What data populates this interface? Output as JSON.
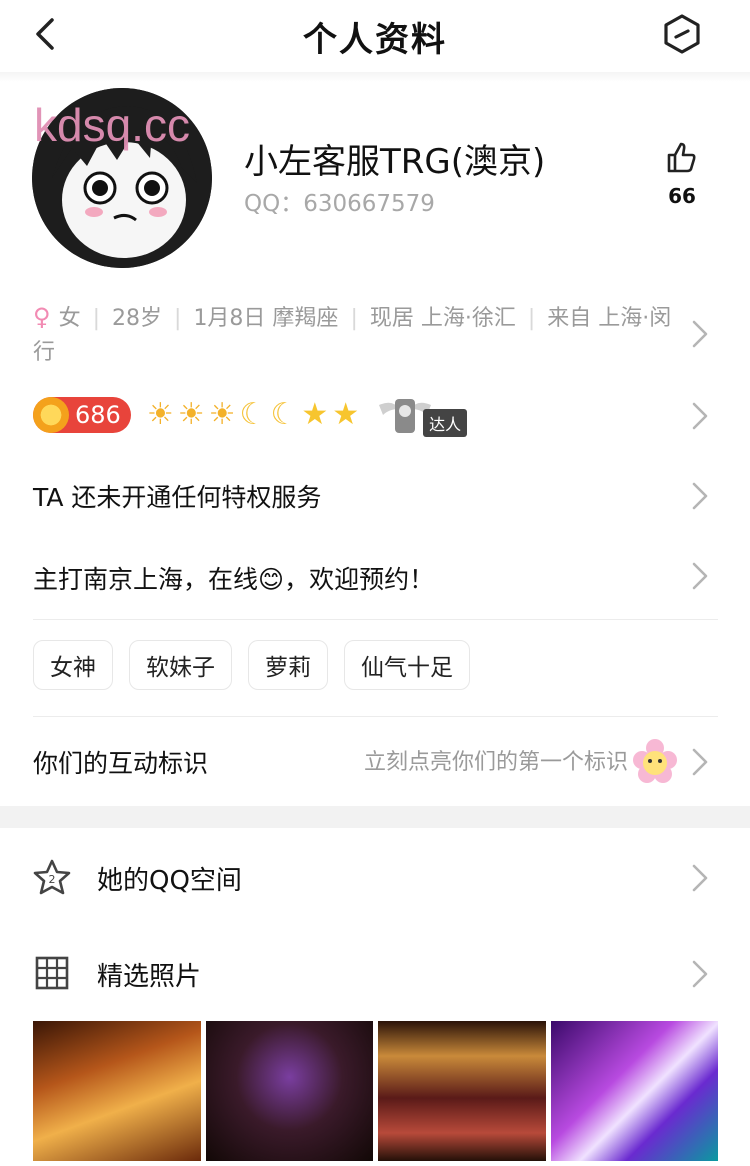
{
  "nav": {
    "title": "个人资料",
    "back_icon": "chevron-left-icon",
    "more_icon": "hexagon-minus-icon"
  },
  "profile": {
    "watermark": "kdsq.cc",
    "nickname": "小左客服TRG(澳京)",
    "qq": "QQ：630667579",
    "likes": "66"
  },
  "info": {
    "gender": "女",
    "age": "28岁",
    "birthday": "1月8日 摩羯座",
    "residence": "现居 上海·徐汇",
    "hometown": "来自 上海·闵行"
  },
  "levels": {
    "level": "686",
    "icons": [
      "☀",
      "☀",
      "☀",
      "☾",
      "☾",
      "★",
      "★"
    ],
    "daren_tag": "达人"
  },
  "privilege": "TA 还未开通任何特权服务",
  "signature": "主打南京上海，在线😊，欢迎预约！",
  "tags": [
    "女神",
    "软妹子",
    "萝莉",
    "仙气十足"
  ],
  "interaction": {
    "label": "你们的互动标识",
    "hint": "立刻点亮你们的第一个标识"
  },
  "menu": {
    "qzone": "她的QQ空间",
    "photos": "精选照片"
  },
  "colors": {
    "accent_pink": "#f28bb3",
    "level_red": "#e8443b",
    "divider": "#ececec"
  }
}
